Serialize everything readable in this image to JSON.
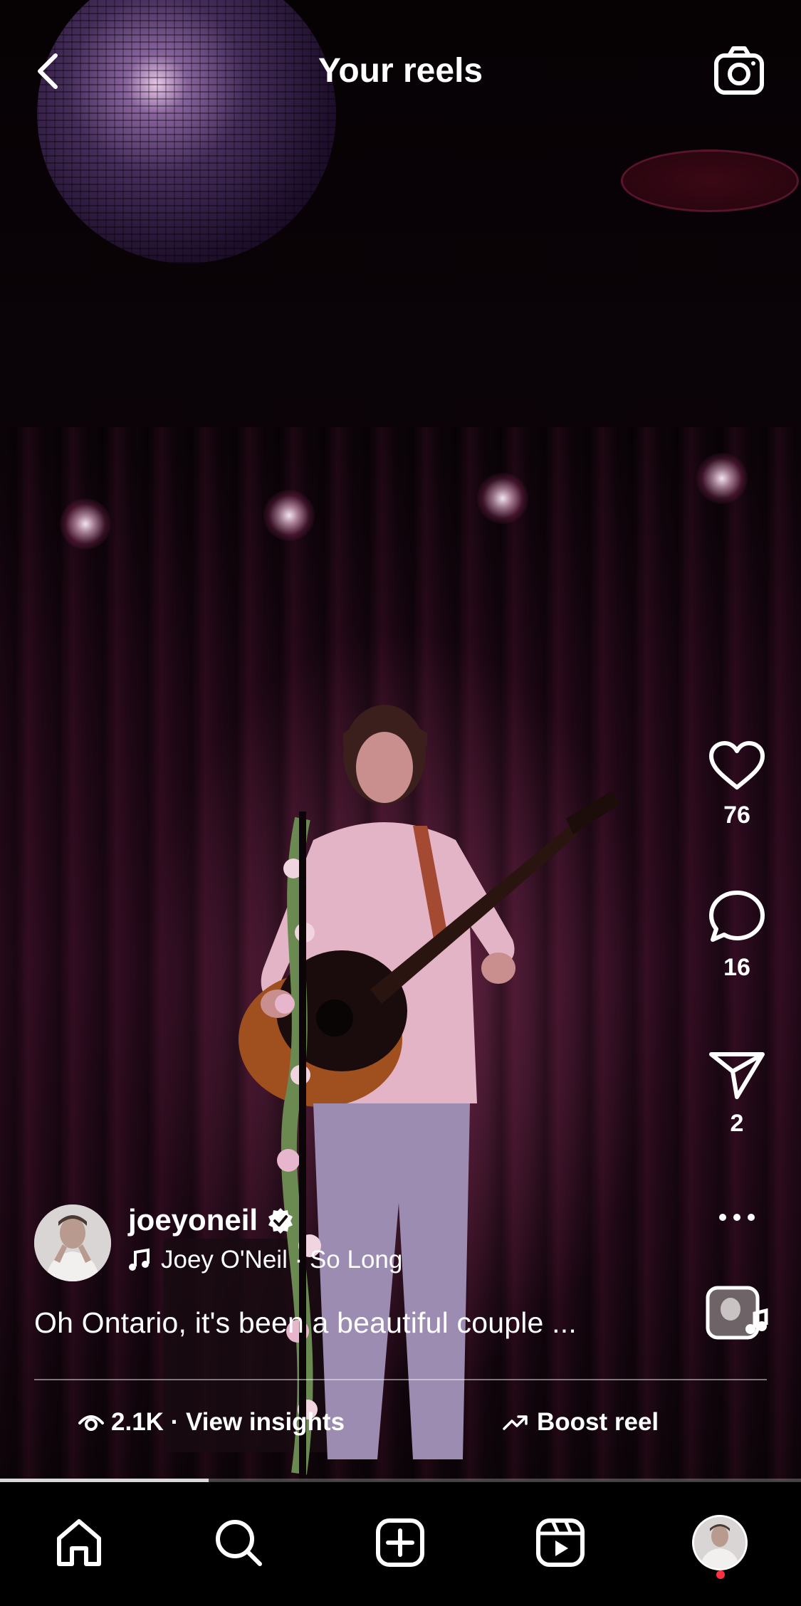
{
  "header": {
    "title": "Your reels"
  },
  "reel": {
    "progress_fraction": 0.26
  },
  "actions": {
    "likes": "76",
    "comments": "16",
    "shares": "2"
  },
  "author": {
    "username": "joeyoneil",
    "audio_artist": "Joey O'Neil",
    "audio_title": "So Long",
    "audio_label": "Joey O'Neil · So Long"
  },
  "caption": {
    "text": "Oh Ontario, it's been a beautiful couple ..."
  },
  "stats": {
    "views": "2.1K",
    "insights_label": "View insights",
    "insights_text": "2.1K · View insights",
    "boost_label": "Boost reel"
  },
  "nav": {
    "items": [
      "home-icon",
      "search-icon",
      "create-icon",
      "reels-icon",
      "profile-avatar"
    ],
    "notification_color": "#ff3040"
  }
}
